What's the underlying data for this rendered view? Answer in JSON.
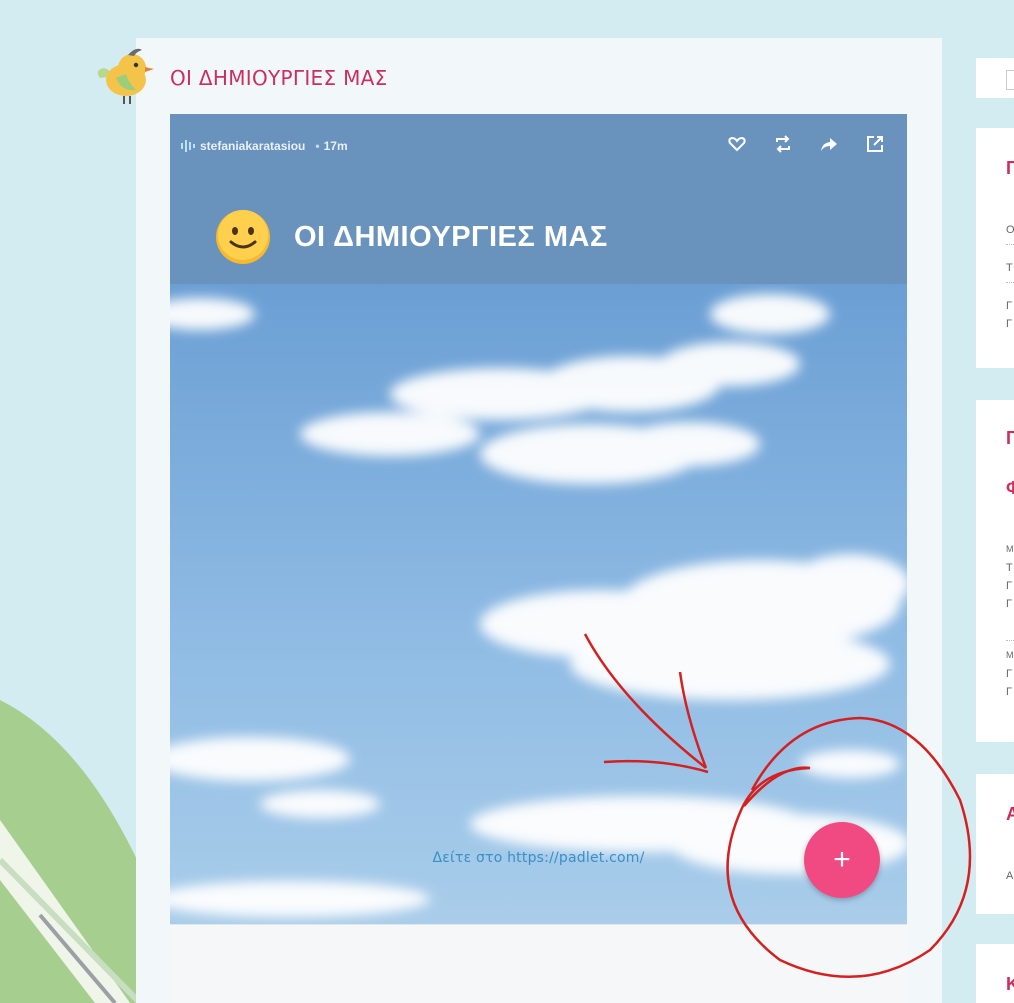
{
  "post": {
    "title": "ΟΙ ΔΗΜΙΟΥΡΓΙΕΣ ΜΑΣ",
    "avatar_icon": "bird-icon"
  },
  "padlet": {
    "author": "stefaniakaratasiou",
    "separator": "•",
    "time_ago": "17m",
    "board_title": "ΟΙ ΔΗΜΙΟΥΡΓΙΕΣ ΜΑΣ",
    "board_icon": "smiley-icon",
    "header_color": "#6992bd",
    "actions": [
      "heart-icon",
      "remix-icon",
      "share-icon",
      "open-external-icon"
    ],
    "add_button_label": "+",
    "add_button_color": "#f14a82",
    "footer_link": "Δείτε στο https://padlet.com/"
  },
  "sidebar": {
    "widgets": [
      {
        "title": "",
        "lines": []
      },
      {
        "title": "Γ",
        "lines": [
          "Ο",
          "Τ",
          "Γ",
          "Γ"
        ]
      },
      {
        "title": "Γ",
        "title2": "Φ",
        "lines": [
          "Μ",
          "Τ",
          "Γ",
          "Γ",
          "Μ",
          "Γ",
          "Γ"
        ]
      },
      {
        "title": "Α",
        "lines": [
          "Α"
        ]
      },
      {
        "title": "Κ",
        "lines": []
      }
    ]
  },
  "colors": {
    "accent": "#c9305e",
    "annotation": "#d42020",
    "background": "#d3ecf2"
  }
}
